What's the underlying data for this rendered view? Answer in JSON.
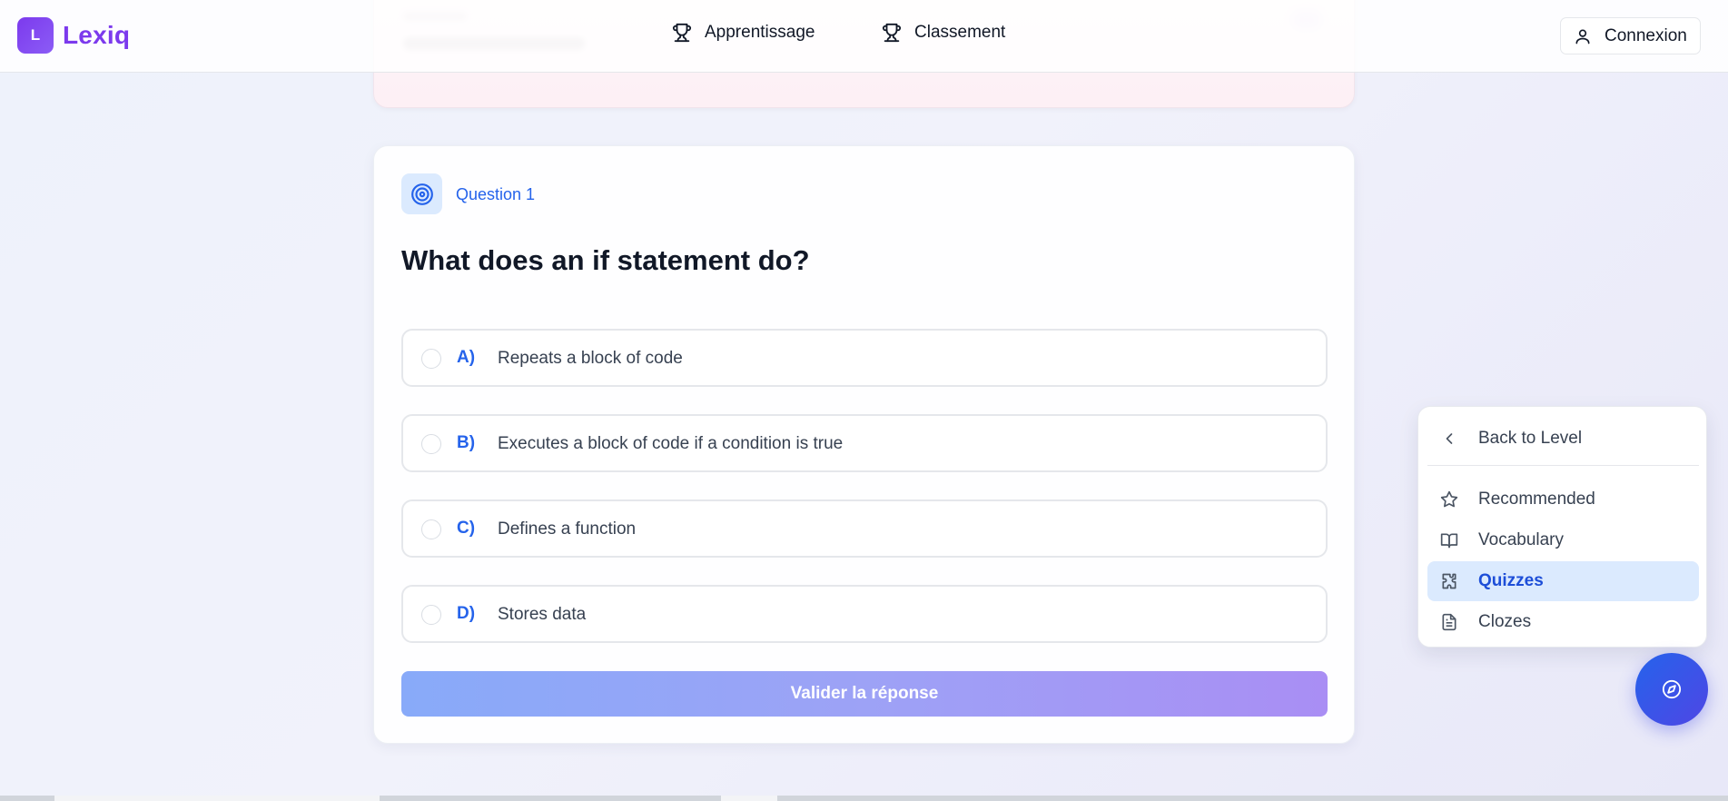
{
  "brand": {
    "logo_letter": "L",
    "name": "Lexiq",
    "accent": "#7c3aed"
  },
  "nav": {
    "learning": "Apprentissage",
    "ranking": "Classement",
    "login": "Connexion"
  },
  "question": {
    "label": "Question 1",
    "text": "What does an if statement do?",
    "options": [
      {
        "letter": "A)",
        "text": "Repeats a block of code"
      },
      {
        "letter": "B)",
        "text": "Executes a block of code if a condition is true"
      },
      {
        "letter": "C)",
        "text": "Defines a function"
      },
      {
        "letter": "D)",
        "text": "Stores data"
      }
    ],
    "submit_label": "Valider la réponse"
  },
  "menu": {
    "back": "Back to Level",
    "items": [
      {
        "label": "Recommended",
        "icon": "star-icon"
      },
      {
        "label": "Vocabulary",
        "icon": "book-icon"
      },
      {
        "label": "Quizzes",
        "icon": "puzzle-icon",
        "active": true
      },
      {
        "label": "Clozes",
        "icon": "document-icon"
      }
    ]
  },
  "colors": {
    "primary": "#2563eb",
    "active_bg": "#dbeafe",
    "submit_gradient_start": "#88aaf9",
    "submit_gradient_end": "#a98ef4"
  }
}
